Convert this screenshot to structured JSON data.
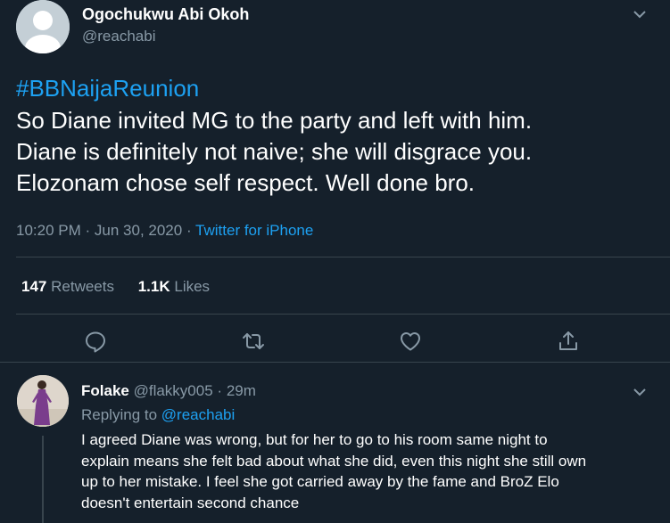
{
  "main_tweet": {
    "author_name": "Ogochukwu Abi Okoh",
    "author_handle": "@reachabi",
    "hashtag": "#BBNaijaReunion",
    "text_lines": [
      "So Diane invited MG to the party and left with him.",
      "Diane is definitely not naive; she will disgrace you.",
      "Elozonam chose self respect. Well done bro."
    ],
    "time": "10:20 PM",
    "date": "Jun 30, 2020",
    "separator": "·",
    "source": "Twitter for iPhone",
    "retweets_count": "147",
    "retweets_label": "Retweets",
    "likes_count": "1.1K",
    "likes_label": "Likes",
    "icons": {
      "more": "chevron-down-icon",
      "reply": "reply-icon",
      "retweet": "retweet-icon",
      "like": "heart-icon",
      "share": "share-icon"
    }
  },
  "reply": {
    "author_name": "Folake",
    "author_handle": "@flakky005",
    "separator": "·",
    "time_ago": "29m",
    "replying_label": "Replying to",
    "replying_to": "@reachabi",
    "text_lines": [
      "I agreed Diane was wrong, but for her to go to his room same night to",
      "explain means she felt bad about what she did, even this night she still own",
      "up to her mistake. I feel she got carried away by the fame and BroZ Elo",
      "doesn't entertain second chance"
    ]
  },
  "colors": {
    "background": "#15202b",
    "text": "#ffffff",
    "muted": "#8899a6",
    "accent": "#1da1f2",
    "border": "#38444d"
  }
}
